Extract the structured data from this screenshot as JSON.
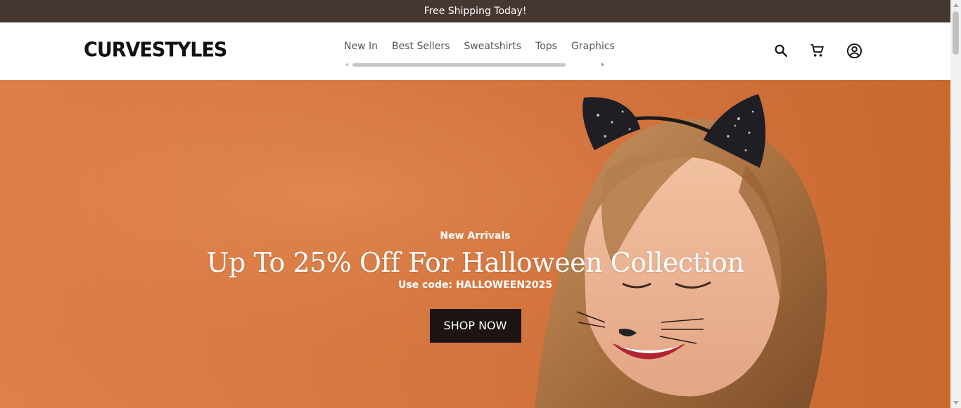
{
  "announcement": {
    "text": "Free Shipping Today!"
  },
  "header": {
    "logo": "CURVESTYLES",
    "nav": [
      {
        "label": "New In"
      },
      {
        "label": "Best Sellers"
      },
      {
        "label": "Sweatshirts"
      },
      {
        "label": "Tops"
      },
      {
        "label": "Graphics"
      }
    ],
    "icons": [
      "search-icon",
      "cart-icon",
      "account-icon"
    ]
  },
  "hero": {
    "eyebrow": "New Arrivals",
    "title": "Up To 25% Off For Halloween Collection",
    "code": "Use code: HALLOWEEN2025",
    "button": "SHOP NOW",
    "background_color": "#d97a44"
  },
  "colors": {
    "announcement_bg": "#473733",
    "button_bg": "#1d1514",
    "text_dark": "#111111"
  }
}
